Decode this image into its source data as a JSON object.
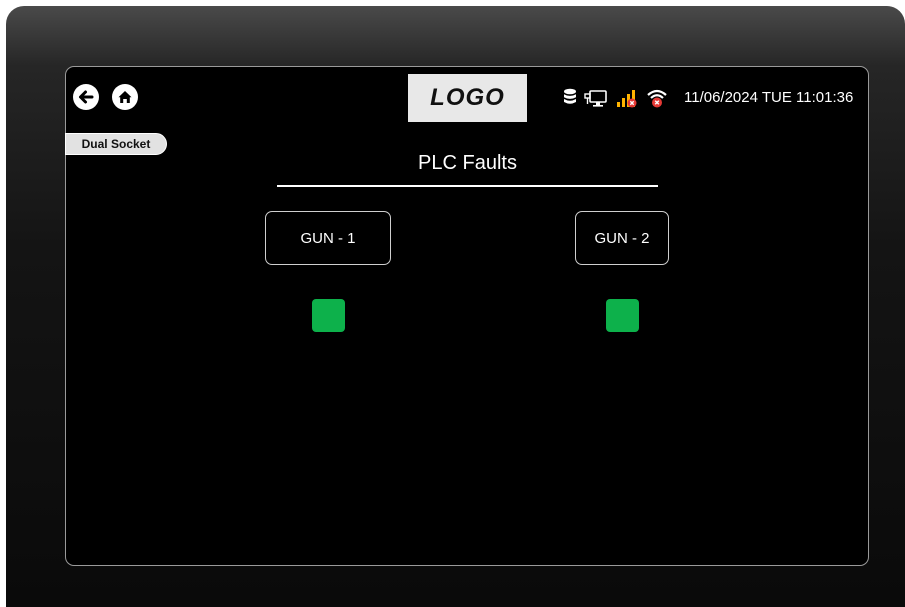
{
  "header": {
    "logo_text": "LOGO",
    "datetime": "11/06/2024 TUE 11:01:36",
    "icons": [
      "back-arrow-icon",
      "home-icon",
      "database-icon",
      "network-monitor-icon",
      "signal-error-icon",
      "wifi-error-icon"
    ]
  },
  "tag": {
    "label": "Dual Socket"
  },
  "page": {
    "title": "PLC Faults"
  },
  "guns": [
    {
      "label": "GUN - 1",
      "status_color": "#0db14b"
    },
    {
      "label": "GUN - 2",
      "status_color": "#0db14b"
    }
  ],
  "colors": {
    "screen_bg": "#000000",
    "ok_indicator": "#0db14b",
    "error_badge": "#e53935"
  }
}
